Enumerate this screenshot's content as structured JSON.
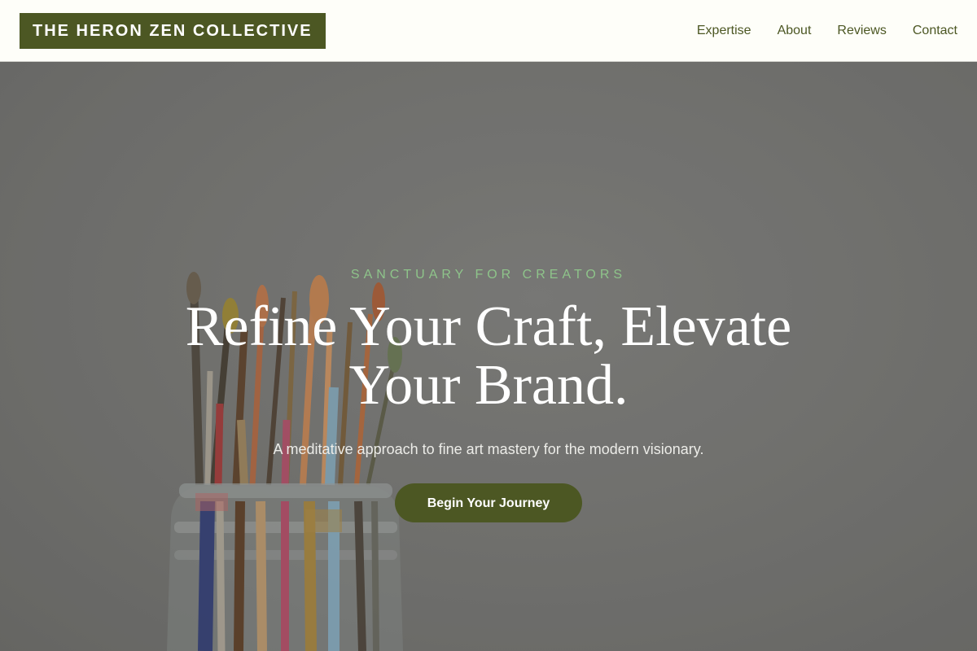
{
  "header": {
    "logo": "THE HERON ZEN COLLECTIVE",
    "nav": [
      {
        "label": "Expertise"
      },
      {
        "label": "About"
      },
      {
        "label": "Reviews"
      },
      {
        "label": "Contact"
      }
    ]
  },
  "hero": {
    "eyebrow": "SANCTUARY FOR CREATORS",
    "headline": "Refine Your Craft, Elevate Your Brand.",
    "subheadline": "A meditative approach to fine art mastery for the modern visionary.",
    "cta_label": "Begin Your Journey",
    "background_image": "paintbrushes-in-glass-jar"
  },
  "colors": {
    "brand": "#4c5723",
    "accent": "#8ec48a",
    "header_bg": "#fefef9"
  }
}
